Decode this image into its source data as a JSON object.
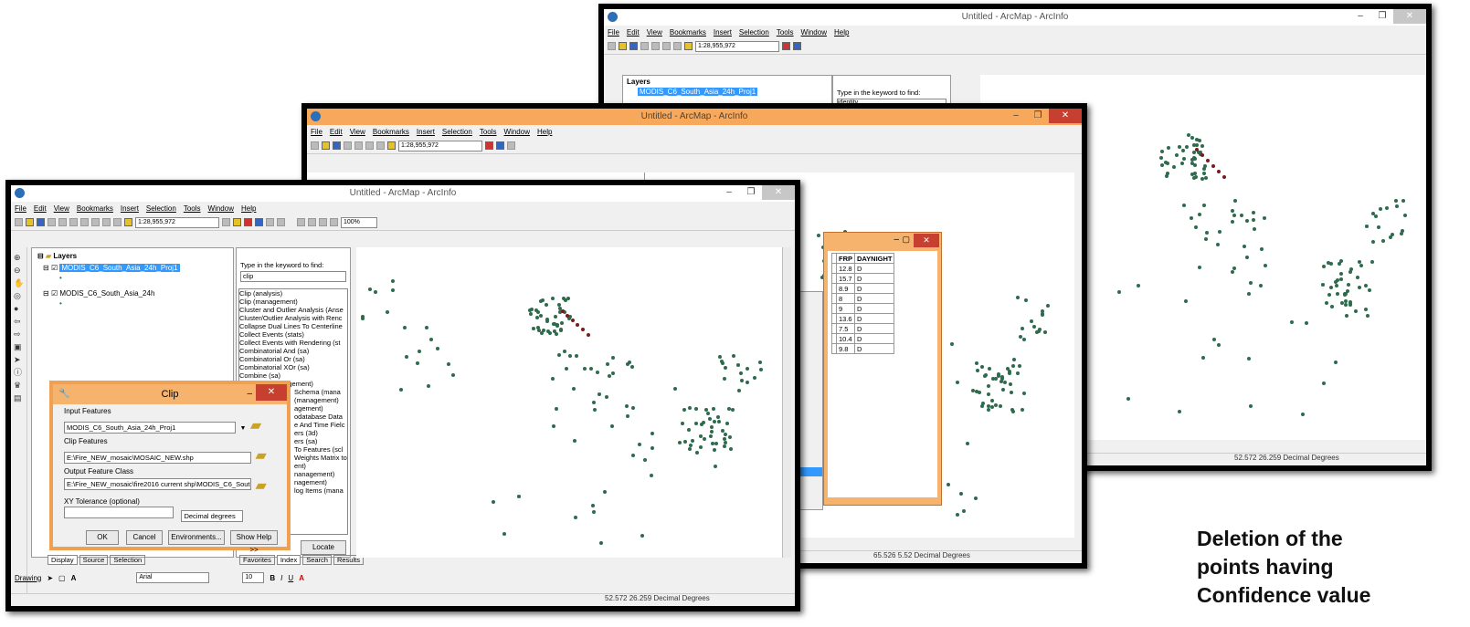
{
  "app": {
    "title": "Untitled - ArcMap - ArcInfo"
  },
  "menu": {
    "items": [
      "File",
      "Edit",
      "View",
      "Bookmarks",
      "Insert",
      "Selection",
      "Tools",
      "Window",
      "Help"
    ]
  },
  "toolbar": {
    "scale_value": "1:28,955,972",
    "zoom_value": "100%"
  },
  "toc": {
    "root": "Layers",
    "layer1": "MODIS_C6_South_Asia_24h_Proj1",
    "layer2": "MODIS_C6_South_Asia_24h"
  },
  "search": {
    "prompt": "Type in the keyword to find:",
    "query_front": "clip",
    "query_back": "identity",
    "results": [
      "Clip (analysis)",
      "Clip (management)",
      "Cluster and Outlier Analysis (Anse",
      "Cluster/Outlier Analysis with Renc",
      "Collapse Dual Lines To Centerline",
      "Collect Events (stats)",
      "Collect Events with Rendering (st",
      "Combinatorial And (sa)",
      "Combinatorial Or (sa)",
      "Combinatorial XOr (sa)",
      "Combine (sa)",
      "Compact (management)"
    ],
    "results_tail": [
      "Schema (mana",
      "(management)",
      "agement)",
      "odatabase Data",
      "",
      "e And Time Fielc",
      "",
      "",
      "",
      "ers (3d)",
      "ers (sa)",
      "To Features (scl",
      "Weights Matrix to",
      "ent)",
      "nanagement)",
      "nagement)",
      "log Items (mana"
    ],
    "locate": "Locate",
    "tabs": [
      "Favorites",
      "Index",
      "Search",
      "Results"
    ]
  },
  "clip_dialog": {
    "title": "Clip",
    "input_label": "Input Features",
    "input_value": "MODIS_C6_South_Asia_24h_Proj1",
    "clip_label": "Clip Features",
    "clip_value": "E:\\Fire_NEW_mosaic\\MOSAIC_NEW.shp",
    "output_label": "Output Feature Class",
    "output_value": "E:\\Fire_NEW_mosaic\\fire2016 current shp\\MODIS_C6_South_Asia_",
    "xy_label": "XY Tolerance (optional)",
    "units": "Decimal degrees",
    "ok": "OK",
    "cancel": "Cancel",
    "env": "Environments...",
    "help": "Show Help >>"
  },
  "toc_tabs": [
    "Display",
    "Source",
    "Selection"
  ],
  "drawing": {
    "label": "Drawing",
    "font": "Arial",
    "size": "10"
  },
  "attr_table": {
    "headers": [
      "FRP",
      "DAYNIGHT"
    ],
    "rows": [
      [
        "12.8",
        "D"
      ],
      [
        "15.7",
        "D"
      ],
      [
        "8.9",
        "D"
      ],
      [
        "8",
        "D"
      ],
      [
        "9",
        "D"
      ],
      [
        "13.6",
        "D"
      ],
      [
        "7.5",
        "D"
      ],
      [
        "10.4",
        "D"
      ],
      [
        "9.8",
        "D"
      ]
    ]
  },
  "status": {
    "front": "52.572  26.259 Decimal Degrees",
    "middle": "65.526  5.52 Decimal Degrees",
    "back": "52.572  26.259 Decimal Degrees"
  },
  "caption": {
    "line1": "Deletion of the",
    "line2": "points having",
    "line3": "Confidence value"
  },
  "colors": {
    "point": "#2e6b4c",
    "selected": "#7a1c1c",
    "dialog_frame": "#f0a052"
  }
}
